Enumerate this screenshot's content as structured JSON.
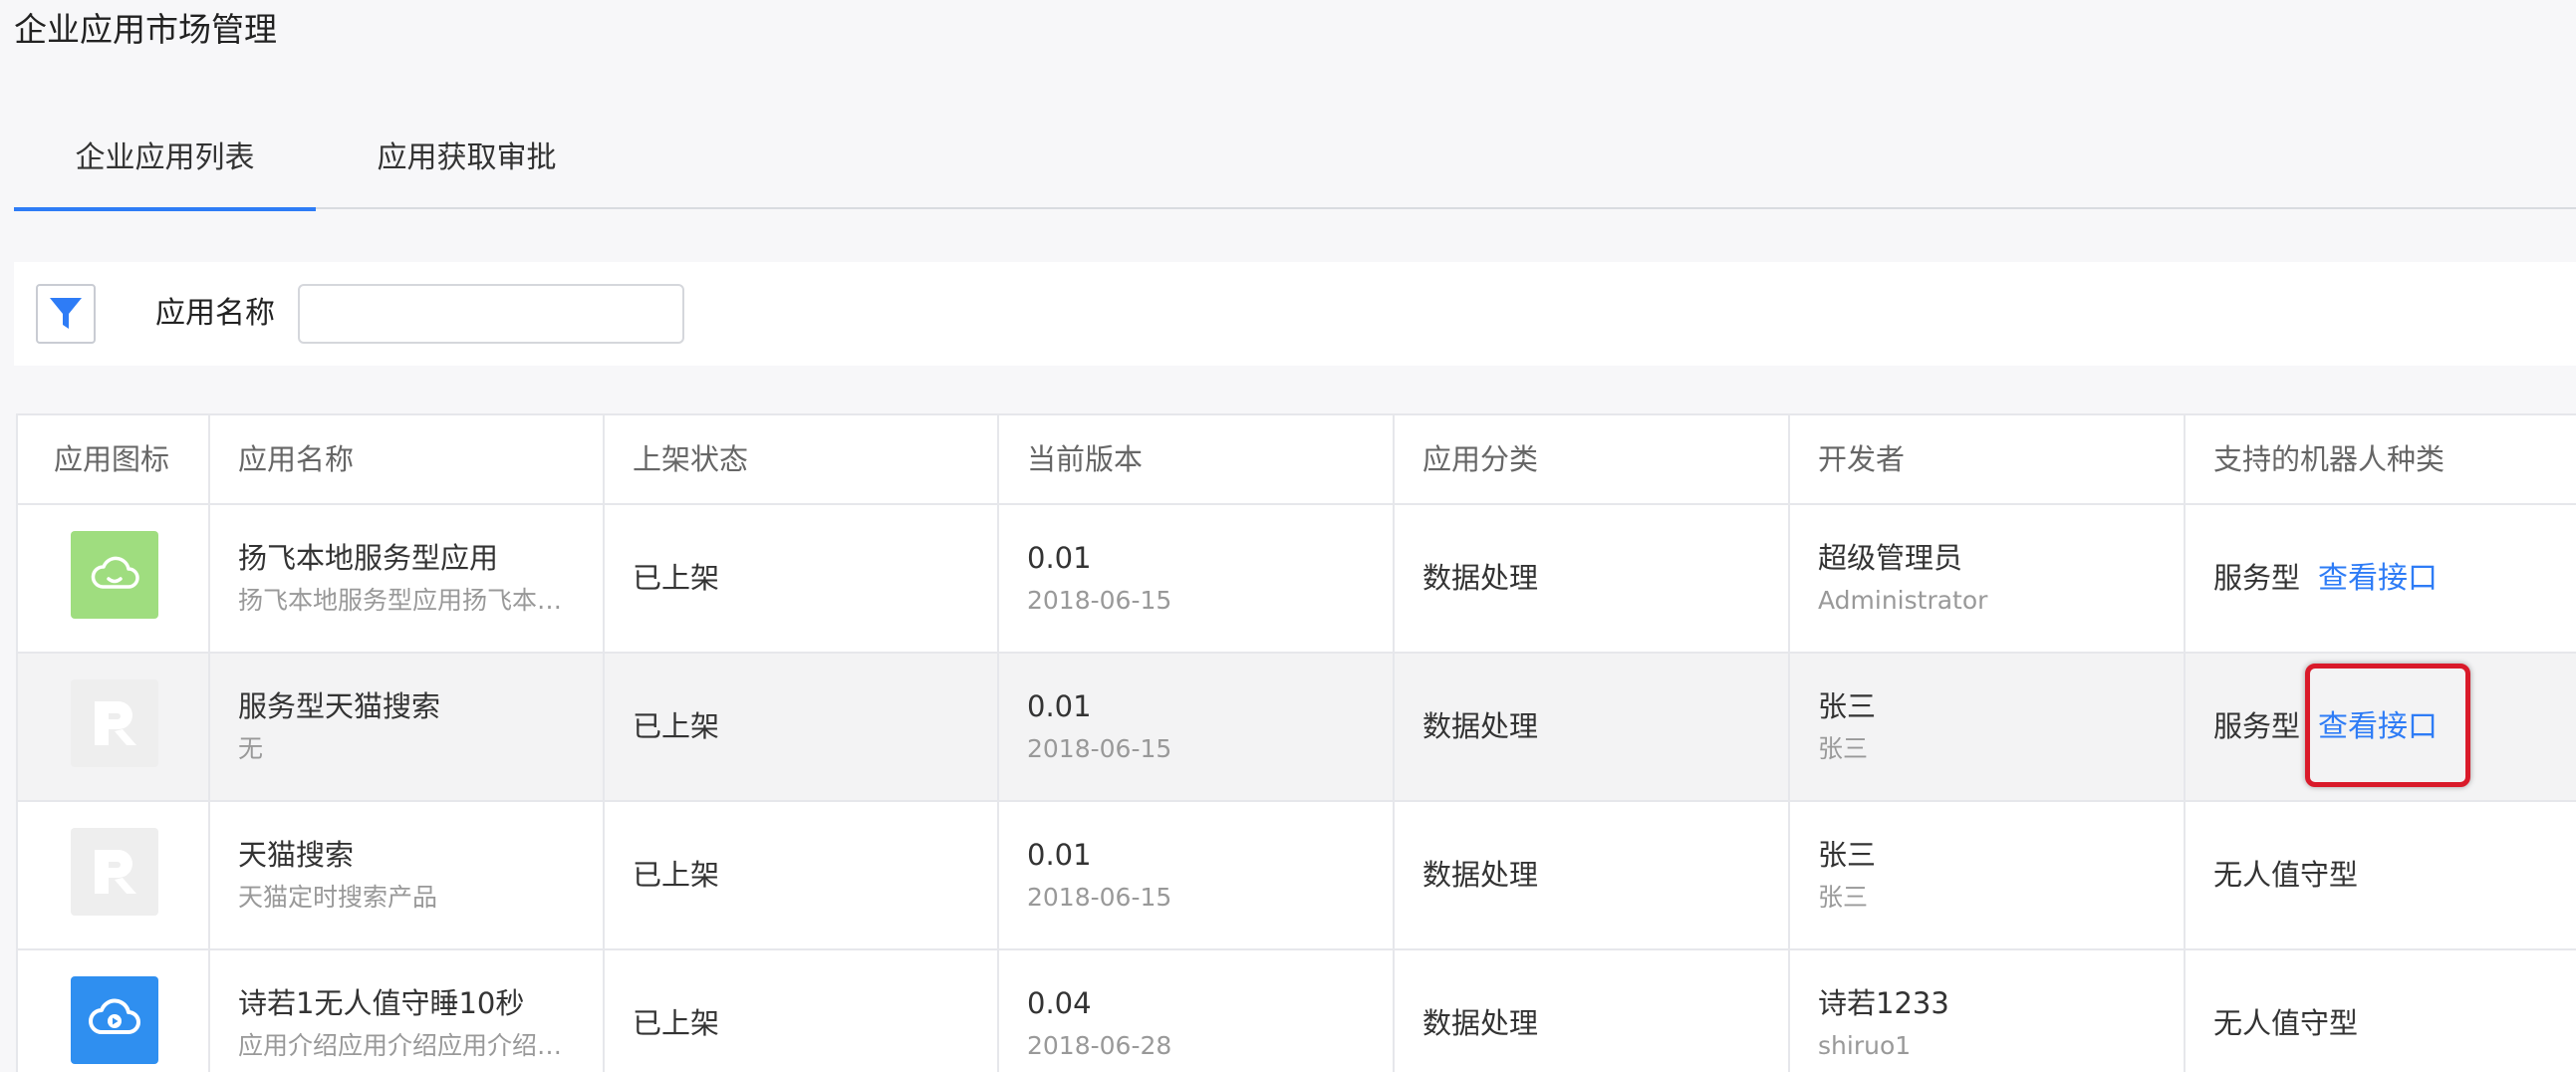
{
  "page": {
    "title": "企业应用市场管理"
  },
  "tabs": [
    {
      "label": "企业应用列表",
      "active": true
    },
    {
      "label": "应用获取审批",
      "active": false
    }
  ],
  "filter": {
    "label": "应用名称",
    "value": "",
    "icon": "filter-icon"
  },
  "table": {
    "headers": [
      "应用图标",
      "应用名称",
      "上架状态",
      "当前版本",
      "应用分类",
      "开发者",
      "支持的机器人种类"
    ],
    "rows": [
      {
        "icon": "cloud-icon",
        "icon_color": "#9fdd7f",
        "name": "扬飞本地服务型应用",
        "desc": "扬飞本地服务型应用扬飞本…",
        "status": "已上架",
        "version": "0.01",
        "date": "2018-06-15",
        "category": "数据处理",
        "developer": "超级管理员",
        "developer_sub": "Administrator",
        "robot_type": "服务型",
        "link": "查看接口"
      },
      {
        "icon": "placeholder-logo-icon",
        "icon_color": "#eeeeee",
        "name": "服务型天猫搜索",
        "desc": "无",
        "status": "已上架",
        "version": "0.01",
        "date": "2018-06-15",
        "category": "数据处理",
        "developer": "张三",
        "developer_sub": "张三",
        "robot_type": "服务型",
        "link": "查看接口"
      },
      {
        "icon": "placeholder-logo-icon",
        "icon_color": "#eeeeee",
        "name": "天猫搜索",
        "desc": "天猫定时搜索产品",
        "status": "已上架",
        "version": "0.01",
        "date": "2018-06-15",
        "category": "数据处理",
        "developer": "张三",
        "developer_sub": "张三",
        "robot_type": "无人值守型",
        "link": ""
      },
      {
        "icon": "cloud-play-icon",
        "icon_color": "#2f8ff0",
        "name": "诗若1无人值守睡10秒",
        "desc": "应用介绍应用介绍应用介绍…",
        "status": "已上架",
        "version": "0.04",
        "date": "2018-06-28",
        "category": "数据处理",
        "developer": "诗若1233",
        "developer_sub": "shiruo1",
        "robot_type": "无人值守型",
        "link": ""
      }
    ]
  },
  "colors": {
    "accent": "#2e7cf6",
    "highlight_border": "#d91a2a",
    "row_highlight": "#f3f3f4"
  }
}
